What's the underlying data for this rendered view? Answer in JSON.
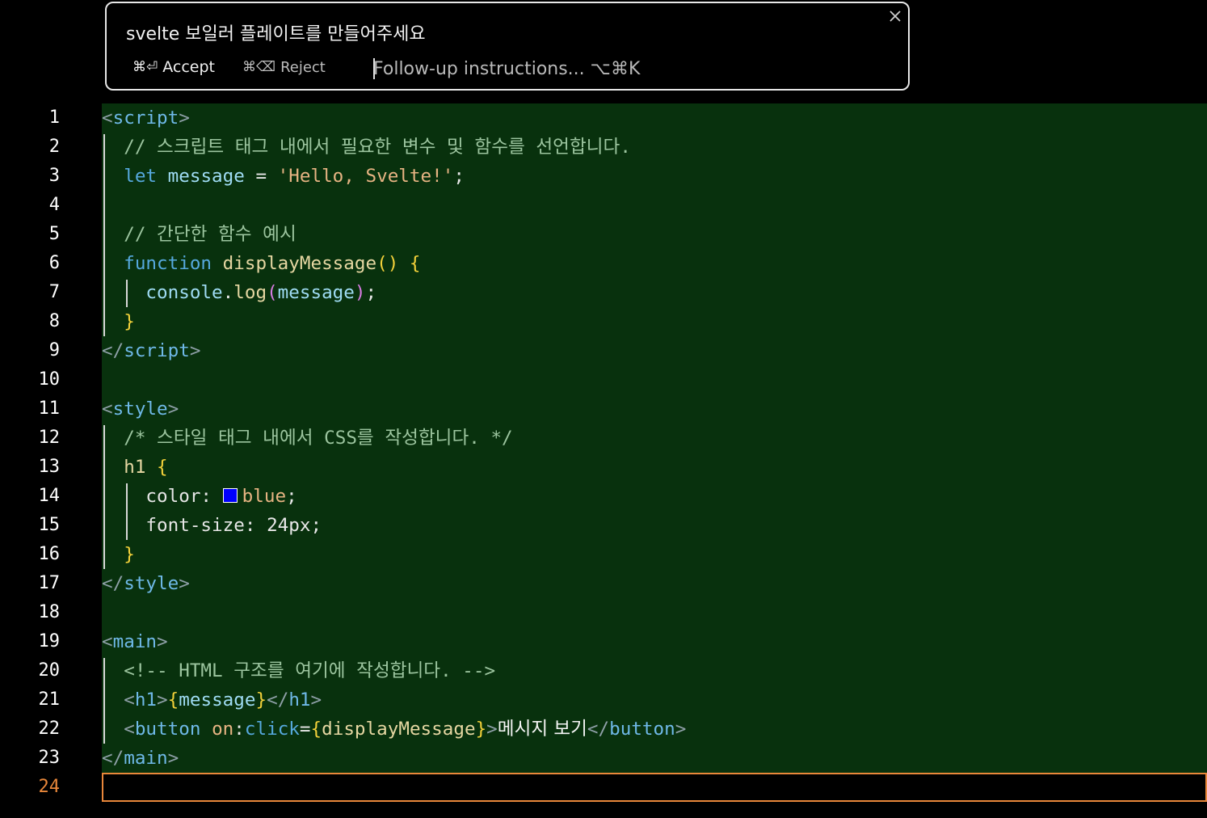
{
  "prompt": {
    "text": "svelte 보일러 플레이트를 만들어주세요",
    "accept_kbd": "⌘⏎",
    "accept_label": "Accept",
    "reject_kbd": "⌘⌫",
    "reject_label": "Reject",
    "followup_placeholder": "Follow-up instructions... ⌥⌘K"
  },
  "editor": {
    "active_line": 24,
    "line_numbers": [
      "1",
      "2",
      "3",
      "4",
      "5",
      "6",
      "7",
      "8",
      "9",
      "10",
      "11",
      "12",
      "13",
      "14",
      "15",
      "16",
      "17",
      "18",
      "19",
      "20",
      "21",
      "22",
      "23",
      "24"
    ],
    "tokens": {
      "l1_tag": "script",
      "l2_comment": "// 스크립트 태그 내에서 필요한 변수 및 함수를 선언합니다.",
      "l3_let": "let",
      "l3_var": "message",
      "l3_eq": " = ",
      "l3_str": "'Hello, Svelte!'",
      "l3_semi": ";",
      "l5_comment": "// 간단한 함수 예시",
      "l6_kw": "function",
      "l6_fn": "displayMessage",
      "l6_parens": "()",
      "l6_brace": "{",
      "l7_obj": "console",
      "l7_dot": ".",
      "l7_fn": "log",
      "l7_open": "(",
      "l7_arg": "message",
      "l7_close": ")",
      "l7_semi": ";",
      "l8_brace": "}",
      "l9_tag": "script",
      "l11_tag": "style",
      "l12_comment": "/* 스타일 태그 내에서 CSS를 작성합니다. */",
      "l13_sel": "h1",
      "l13_brace": "{",
      "l14_prop": "color:",
      "l14_val": "blue",
      "l14_semi": ";",
      "l15_prop": "font-size:",
      "l15_val": "24px",
      "l15_semi": ";",
      "l16_brace": "}",
      "l17_tag": "style",
      "l19_tag": "main",
      "l20_comment": "<!-- HTML 구조를 여기에 작성합니다. -->",
      "l21_tag": "h1",
      "l21_open": "{",
      "l21_var": "message",
      "l21_close": "}",
      "l22_tag": "button",
      "l22_attr": "on",
      "l22_colon": ":",
      "l22_event": "click",
      "l22_eq": "=",
      "l22_open": "{",
      "l22_fn": "displayMessage",
      "l22_close": "}",
      "l22_text": "메시지 보기",
      "l23_tag": "main"
    }
  },
  "colors": {
    "added_bg": "#08310d",
    "active_line_border": "#e8873a",
    "swatch_blue": "#0000ff"
  }
}
